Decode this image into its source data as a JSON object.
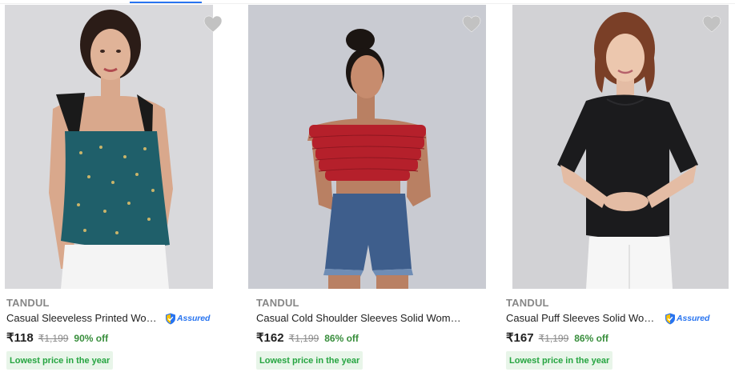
{
  "products": [
    {
      "brand": "TANDUL",
      "title": "Casual Sleeveless Printed Women Top",
      "assured": true,
      "assured_label": "Assured",
      "price": "₹118",
      "mrp": "₹1,199",
      "discount": "90% off",
      "tag": "Lowest price in the year",
      "image": "model-in-teal-printed-smocked-sleeveless-top",
      "colors": {
        "background": "#d9d9dc",
        "garment": "#1f5f6a",
        "bottom": "#f4f4f4"
      }
    },
    {
      "brand": "TANDUL",
      "title": "Casual Cold Shoulder Sleeves Solid Women Top",
      "assured": false,
      "assured_label": "",
      "price": "₹162",
      "mrp": "₹1,199",
      "discount": "86% off",
      "tag": "Lowest price in the year",
      "image": "model-in-red-ruffled-off-shoulder-top",
      "colors": {
        "background": "#c9cbd2",
        "garment": "#b5202b",
        "bottom": "#3e5e8c"
      }
    },
    {
      "brand": "TANDUL",
      "title": "Casual Puff Sleeves Solid Women Top",
      "assured": true,
      "assured_label": "Assured",
      "price": "₹167",
      "mrp": "₹1,199",
      "discount": "86% off",
      "tag": "Lowest price in the year",
      "image": "model-in-black-puff-sleeve-top",
      "colors": {
        "background": "#d2d2d5",
        "garment": "#1b1b1d",
        "bottom": "#f6f6f6"
      }
    }
  ],
  "icons": {
    "wishlist": "heart-icon",
    "assured": "shield-check-icon"
  },
  "theme": {
    "accent": "#2874f0",
    "green": "#388e3c",
    "muted": "#878787"
  }
}
